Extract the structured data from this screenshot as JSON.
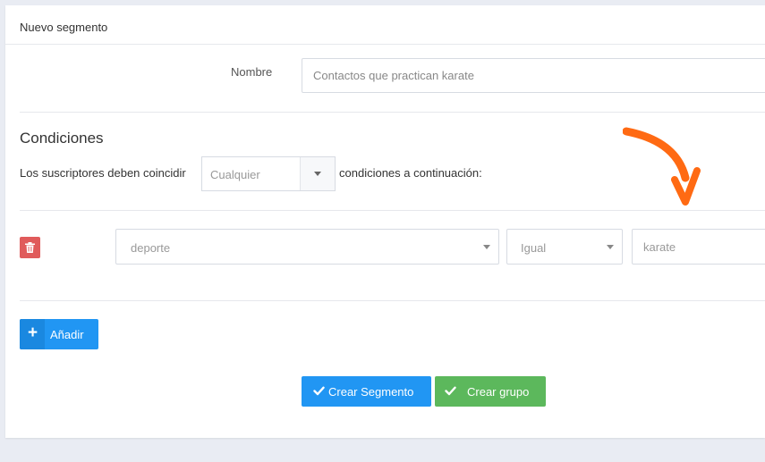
{
  "panel": {
    "title": "Nuevo segmento"
  },
  "name_field": {
    "label": "Nombre",
    "value": "Contactos que practican karate"
  },
  "conditions": {
    "title": "Condiciones",
    "match_prefix": "Los suscriptores deben coincidir",
    "match_value": "Cualquier",
    "match_suffix": "condiciones a continuación:",
    "rule": {
      "field": "deporte",
      "operator": "Igual",
      "value": "karate"
    }
  },
  "buttons": {
    "add_label": "Añadir",
    "create_segment_label": "Crear Segmento",
    "create_group_label": "Crear grupo"
  },
  "icons": {
    "delete": "trash-icon",
    "add": "plus-icon",
    "confirm": "check-icon",
    "annotation": "curved-arrow-icon"
  },
  "colors": {
    "primary": "#2196f3",
    "success": "#5cb85c",
    "danger": "#e05b5b",
    "annotation_arrow": "#ff6a13"
  }
}
